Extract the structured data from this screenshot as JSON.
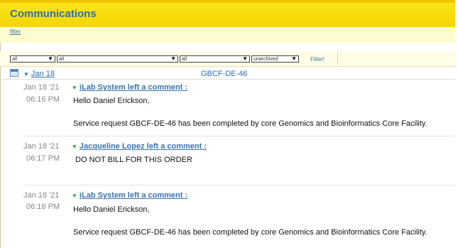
{
  "header": {
    "title": "Communications",
    "filter_link": "filter"
  },
  "toolbar": {
    "selects": [
      "all",
      "all",
      "all",
      "unarchived"
    ],
    "filter_button": "Filter!"
  },
  "group": {
    "date": "Jan 18",
    "request_id": "GBCF-DE-46"
  },
  "comments": [
    {
      "date": "Jan 18 '21",
      "time": "06:16 PM",
      "author": "iLab System left a comment :",
      "lines": [
        "Hello Daniel Erickson,",
        "Service request GBCF-DE-46 has been completed by core Genomics and Bioinformatics Core Facility."
      ]
    },
    {
      "date": "Jan 18 '21",
      "time": "06:17 PM",
      "author": "Jacqueline Lopez left a comment :",
      "lines": [
        "DO NOT BILL FOR THIS ORDER"
      ]
    },
    {
      "date": "Jan 18 '21",
      "time": "06:18 PM",
      "author": "iLab System left a comment :",
      "lines": [
        "Hello Daniel Erickson,",
        "Service request GBCF-DE-46 has been completed by core Genomics and Bioinformatics Core Facility."
      ]
    }
  ],
  "icons": {
    "calendar": "calendar-icon",
    "expand": "triangle-down-icon"
  }
}
